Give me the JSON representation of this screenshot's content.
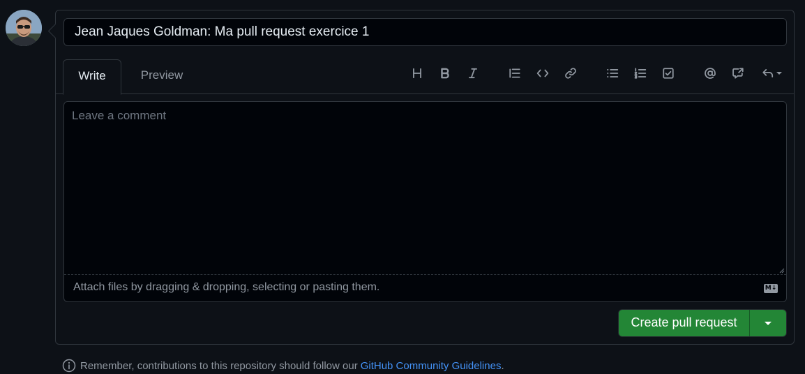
{
  "pr": {
    "title_value": "Jean Jaques Goldman: Ma pull request exercice 1"
  },
  "tabs": {
    "write": "Write",
    "preview": "Preview"
  },
  "toolbar": {
    "icons": [
      "heading-icon",
      "bold-icon",
      "italic-icon",
      "quote-icon",
      "code-icon",
      "link-icon",
      "unordered-list-icon",
      "ordered-list-icon",
      "task-list-icon",
      "mention-icon",
      "cross-reference-icon",
      "saved-replies-icon"
    ]
  },
  "editor": {
    "placeholder": "Leave a comment",
    "attach_text": "Attach files by dragging & dropping, selecting or pasting them.",
    "markdown_badge": "M↓"
  },
  "actions": {
    "create_label": "Create pull request"
  },
  "footer": {
    "note": "Remember, contributions to this repository should follow our",
    "link": "GitHub Community Guidelines",
    "suffix": "."
  },
  "colors": {
    "background": "#0d1117",
    "primary_button": "#238636",
    "link": "#4493f8",
    "muted_text": "#9198a1",
    "border": "#30363d"
  }
}
